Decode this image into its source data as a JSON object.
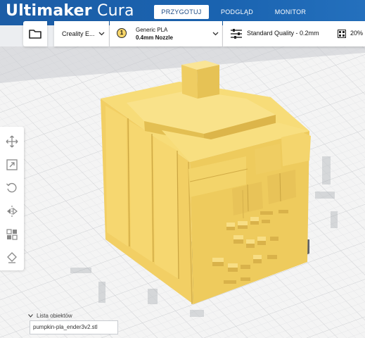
{
  "app": {
    "brand": "Ultimaker",
    "product": " Cura"
  },
  "stages": [
    {
      "label": "PRZYGOTUJ",
      "active": true
    },
    {
      "label": "PODGLĄD",
      "active": false
    },
    {
      "label": "MONITOR",
      "active": false
    }
  ],
  "toolbar": {
    "open_icon": "folder-icon",
    "printer": "Creality E...",
    "material": {
      "extruder_number": "1",
      "name": "Generic PLA",
      "nozzle": "0.4mm Nozzle"
    },
    "print_settings": {
      "icon": "sliders-icon",
      "profile": "Standard Quality - 0.2mm",
      "infill_icon": "infill-icon",
      "infill": "20%"
    }
  },
  "tools": [
    {
      "name": "move-tool",
      "icon": "move-icon"
    },
    {
      "name": "scale-tool",
      "icon": "scale-icon"
    },
    {
      "name": "rotate-tool",
      "icon": "rotate-icon"
    },
    {
      "name": "mirror-tool",
      "icon": "mirror-icon"
    },
    {
      "name": "per-model-settings-tool",
      "icon": "per-model-settings-icon"
    },
    {
      "name": "support-blocker-tool",
      "icon": "support-blocker-icon"
    }
  ],
  "object_list": {
    "label": "Lista obiektów",
    "files": [
      "pumpkin-pla_ender3v2.stl"
    ]
  },
  "colors": {
    "header": "#195ea7",
    "model": "#f5d469",
    "build_plate": "#f3f3f3"
  }
}
